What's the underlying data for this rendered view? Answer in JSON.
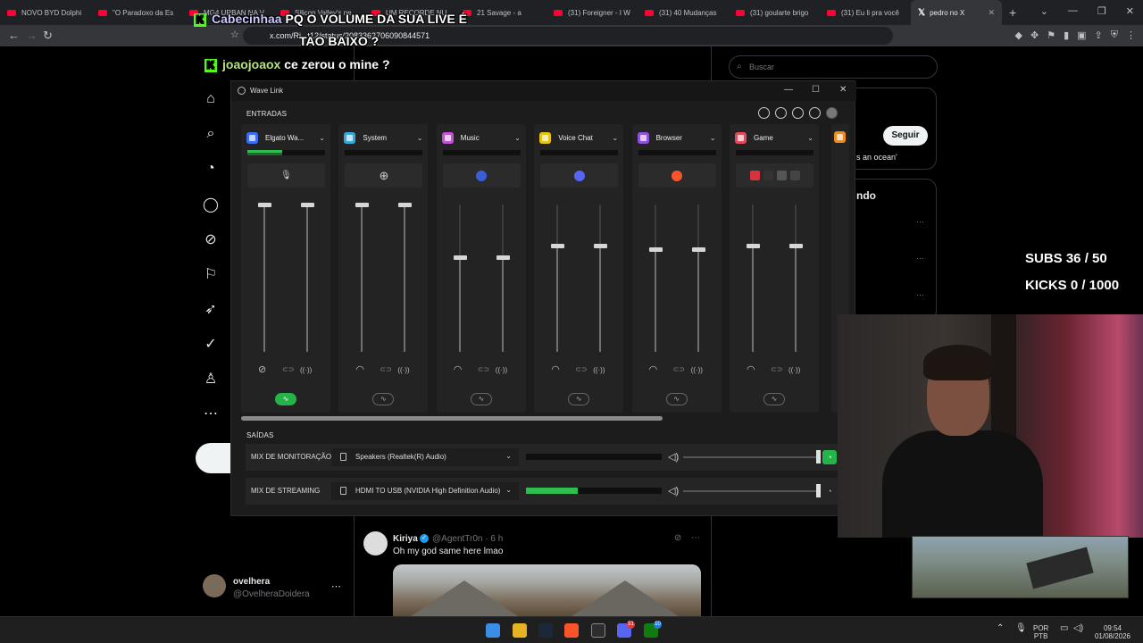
{
  "browser": {
    "tabs": [
      {
        "label": "NOVO BYD Dolphi"
      },
      {
        "label": "\"O Paradoxo da Es"
      },
      {
        "label": "MG4 URBAN NA V"
      },
      {
        "label": "Silicon Valley's ne"
      },
      {
        "label": "UM RECORDE NU"
      },
      {
        "label": "21 Savage - a"
      },
      {
        "label": "(31) Foreigner - I W"
      },
      {
        "label": "(31) 40 Mudanças"
      },
      {
        "label": "(31) goularte brigo"
      },
      {
        "label": "(31) Eu li pra você"
      },
      {
        "label": "pedro no X"
      }
    ],
    "url": "x.com/Ri...t12/status/2083362706090844571"
  },
  "overlay": {
    "chat": [
      {
        "user": "Cabecinhaa",
        "message": "PQ O VOLUME DA SUA LIVE É"
      },
      {
        "user": "",
        "message": "TAO BAIXO ?"
      },
      {
        "user": "joaojoaox",
        "message": "ce zerou o mine ?"
      }
    ],
    "subs": "SUBS 36 / 50",
    "kicks": "KICKS 0 / 1000"
  },
  "xpage": {
    "search_placeholder": "Buscar",
    "follow_label": "Seguir",
    "trend_snippet": "s an ocean'",
    "section_title": "ndo",
    "tweet": {
      "name": "Kiriya",
      "handle": "@AgentTr0n · 6 h",
      "text": "Oh my god same here lmao"
    },
    "account": {
      "name": "ovelhera",
      "handle": "@OvelheraDoidera"
    }
  },
  "wavelink": {
    "title": "Wave Link",
    "inputs_label": "ENTRADAS",
    "outputs_label": "SAÍDAS",
    "channels": [
      {
        "name": "Elgato Wa...",
        "color": "#3b6cf2",
        "meter": 0.45,
        "levels": [
          1.0,
          1.0
        ],
        "fx_on": true
      },
      {
        "name": "System",
        "color": "#34a9d8",
        "meter": 0,
        "levels": [
          1.0,
          1.0
        ],
        "fx_on": false
      },
      {
        "name": "Music",
        "color": "#c251d6",
        "meter": 0,
        "levels": [
          0.64,
          0.64
        ],
        "fx_on": false
      },
      {
        "name": "Voice Chat",
        "color": "#e5c416",
        "meter": 0,
        "levels": [
          0.72,
          0.72
        ],
        "fx_on": false
      },
      {
        "name": "Browser",
        "color": "#8d52d8",
        "meter": 0,
        "levels": [
          0.7,
          0.7
        ],
        "fx_on": false
      },
      {
        "name": "Game",
        "color": "#e24a5c",
        "meter": 0,
        "levels": [
          0.72,
          0.72
        ],
        "fx_on": false
      }
    ],
    "outputs": [
      {
        "label": "MIX DE MONITORAÇÃO",
        "device": "Speakers (Realtek(R) Audio)",
        "meter": 0,
        "volume": 1.0,
        "monitor_active": true
      },
      {
        "label": "MIX DE STREAMING",
        "device": "HDMI TO USB (NVIDIA High Definition Audio)",
        "meter": 0.38,
        "volume": 1.0,
        "monitor_active": false
      }
    ]
  },
  "taskbar": {
    "lang": "POR",
    "layout": "PTB",
    "time": "09:54",
    "date": "01/08/2026",
    "badge_discord": "51",
    "badge_xbox": "10"
  }
}
